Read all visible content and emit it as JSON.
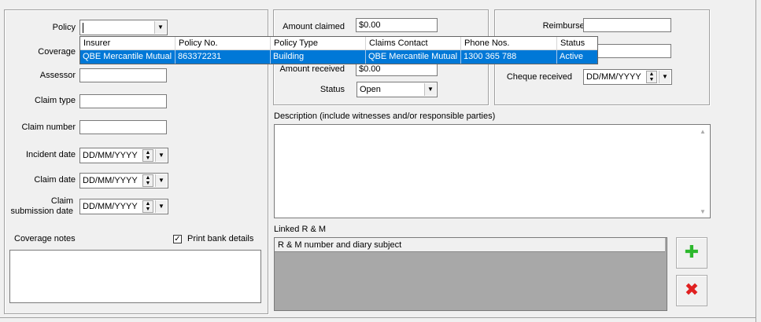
{
  "policy": {
    "label": "Policy",
    "value": "",
    "dropdown": {
      "columns": [
        "Insurer",
        "Policy No.",
        "Policy Type",
        "Claims Contact",
        "Phone Nos.",
        "Status"
      ],
      "rows": [
        [
          "QBE Mercantile Mutual",
          "863372231",
          "Building",
          "QBE Mercantile Mutual",
          "1300 365 788",
          "Active"
        ]
      ]
    }
  },
  "labels": {
    "coverage": "Coverage",
    "assessor": "Assessor",
    "claim_type": "Claim type",
    "claim_number": "Claim number",
    "incident_date": "Incident date",
    "claim_date": "Claim date",
    "claim_submission_date": "Claim submission date",
    "coverage_notes": "Coverage notes",
    "print_bank_details": "Print bank details",
    "amount_claimed": "Amount claimed",
    "amount_received": "Amount received",
    "status": "Status",
    "reimburse_to": "Reimburse to",
    "cheque_received": "Cheque received",
    "description": "Description  (include witnesses and/or responsible parties)",
    "linked_rm": "Linked R & M",
    "rm_column": "R & M number and diary subject"
  },
  "values": {
    "assessor": "",
    "claim_type": "",
    "claim_number": "",
    "date_placeholder": "DD/MM/YYYY",
    "amount_claimed": "$0.00",
    "amount_received": "$0.00",
    "status": "Open",
    "reimburse_to": "",
    "print_bank_details_checked": true
  },
  "icons": {
    "add": "plus-icon",
    "remove": "x-icon"
  },
  "colors": {
    "selection": "#0078d7",
    "add": "#2db82d",
    "remove": "#e02020",
    "grid_bg": "#a8a8a8"
  }
}
